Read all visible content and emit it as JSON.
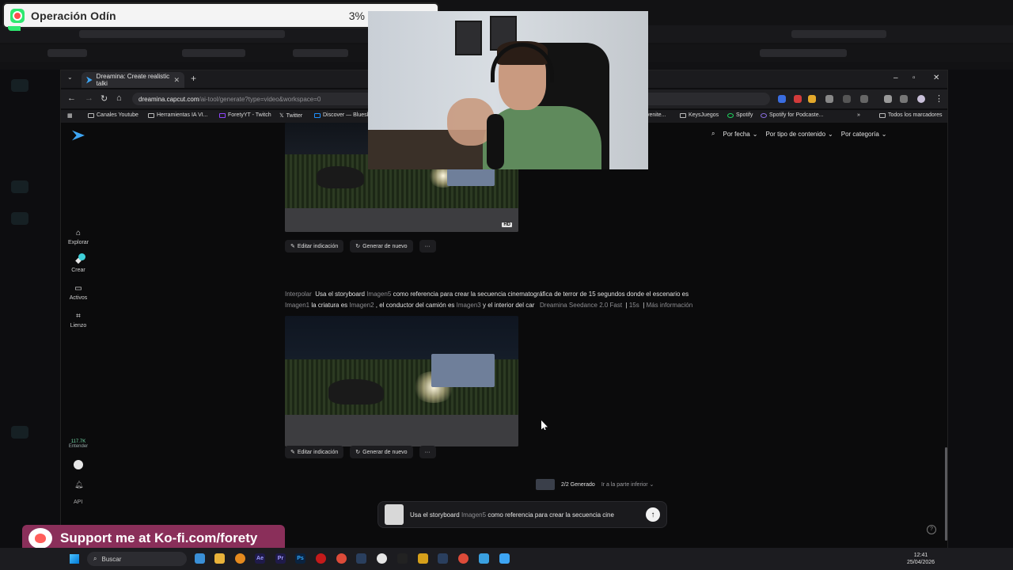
{
  "stream": {
    "goal_title": "Operación Odín",
    "goal_status": "3% of €300 Goal",
    "goal_progress_percent": 3,
    "kofi_text": "Support me at Ko-fi.com/forety"
  },
  "browser": {
    "tab_title": "Dreamina: Create realistic talki",
    "url_host": "dreamina.capcut.com",
    "url_path": "/ai-tool/generate?type=video&workspace=0",
    "bookmarks": [
      "Canales Youtube",
      "Herramientas IA VI...",
      "ForetyYT - Twitch",
      "Twitter",
      "Discover — Bluesk",
      "venite...",
      "KeysJuegos",
      "Spotify",
      "Spotify for Podcaste..."
    ],
    "all_bookmarks": "Todos los marcadores"
  },
  "sidebar": {
    "items": [
      {
        "label": "Explorar",
        "icon": "home-icon"
      },
      {
        "label": "Crear",
        "icon": "create-icon"
      },
      {
        "label": "Activos",
        "icon": "folder-icon"
      },
      {
        "label": "Lienzo",
        "icon": "canvas-icon"
      }
    ],
    "credits_value": "117.7K",
    "credits_label": "Entender",
    "api_label": "API"
  },
  "filters": {
    "by_date": "Por fecha",
    "by_content": "Por tipo de contenido",
    "by_category": "Por categoría"
  },
  "results": {
    "edit_label": "Editar indicación",
    "regenerate_label": "Generar de nuevo",
    "more_label": "···",
    "hd_badge": "HD",
    "prompt": {
      "mode": "Interpolar",
      "text1": "Usa el storyboard",
      "chip1": "Imagen5",
      "text2": "como referencia para crear la secuencia cinematográfica de terror de 15 segundos donde el escenario es",
      "chip2": "Imagen1",
      "text3": "la criatura es",
      "chip3": "Imagen2",
      "text4": ", el conductor del camión es",
      "chip4": "Imagen3",
      "text5": "y el interior del car",
      "model": "Dreamina Seedance 2.0 Fast",
      "duration": "15s",
      "more_info": "Más información"
    }
  },
  "status": {
    "generated": "2/2 Generado",
    "go_bottom": "Ir a la parte inferior"
  },
  "composer": {
    "text1": "Usa el storyboard",
    "chip": "Imagen5",
    "text2": "como referencia para crear la secuencia cine"
  },
  "taskbar": {
    "search_label": "Buscar",
    "time": "12:41",
    "date": "25/04/2026"
  }
}
